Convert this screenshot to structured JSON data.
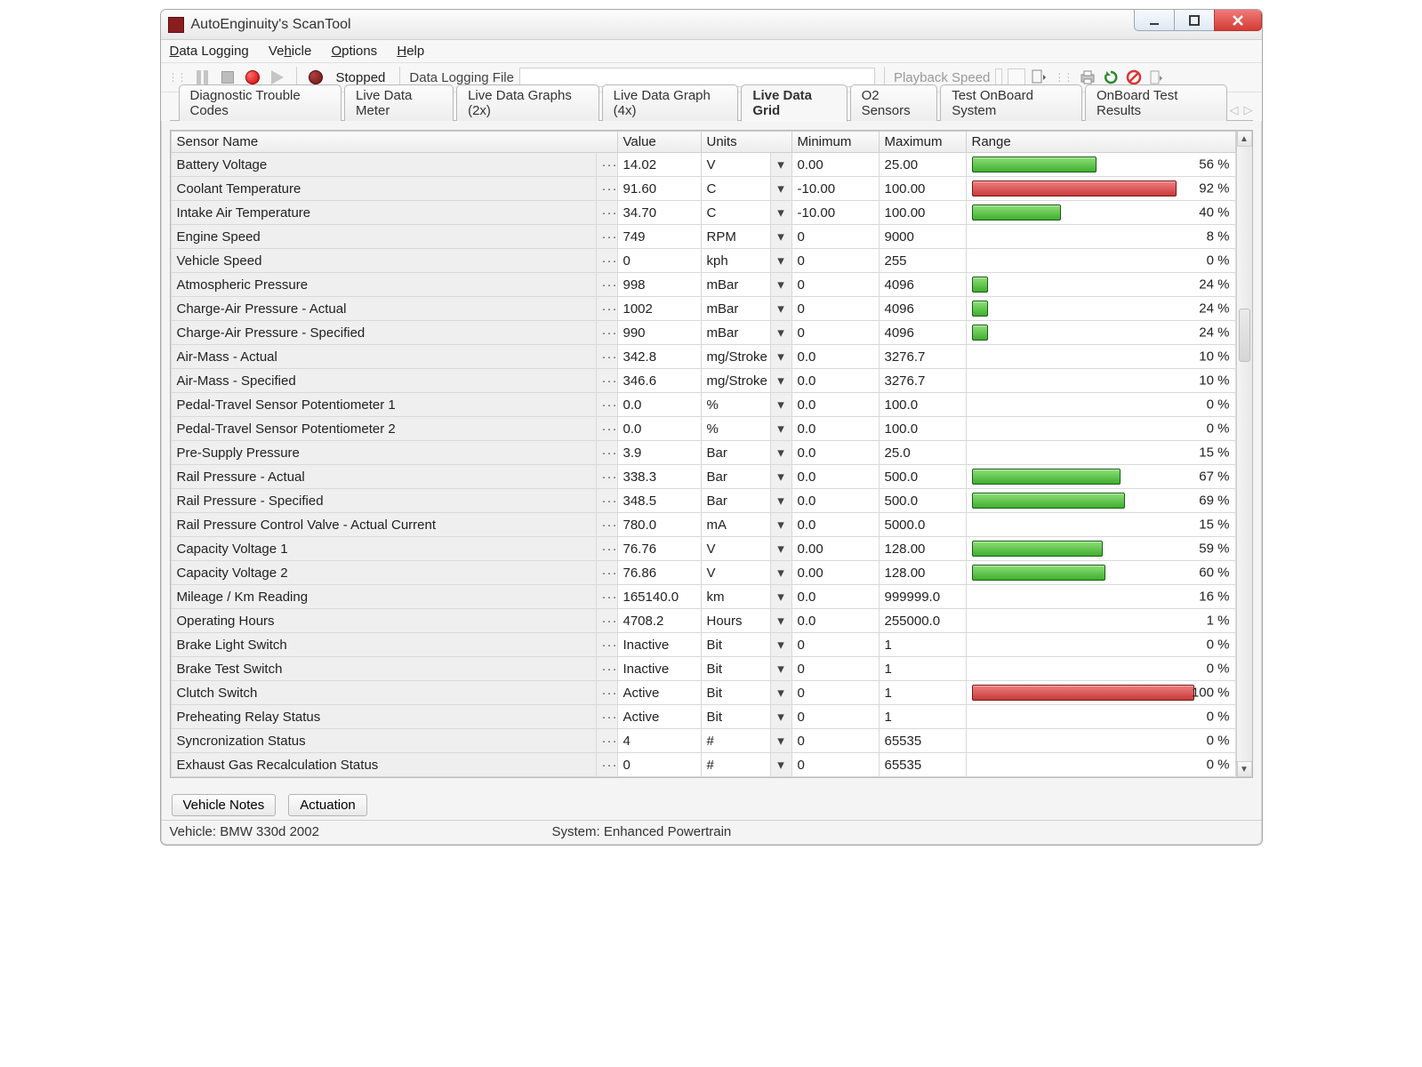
{
  "window": {
    "title": "AutoEnginuity's ScanTool"
  },
  "menu": {
    "data_logging": "Data Logging",
    "vehicle": "Vehicle",
    "options": "Options",
    "help": "Help"
  },
  "toolbar": {
    "stopped_label": "Stopped",
    "dlf_label": "Data Logging File",
    "playback_label": "Playback Speed"
  },
  "tabs": [
    "Diagnostic Trouble Codes",
    "Live Data Meter",
    "Live Data Graphs (2x)",
    "Live Data Graph (4x)",
    "Live Data Grid",
    "O2 Sensors",
    "Test OnBoard System",
    "OnBoard Test Results"
  ],
  "active_tab_index": 4,
  "grid": {
    "headers": {
      "name": "Sensor Name",
      "value": "Value",
      "units": "Units",
      "min": "Minimum",
      "max": "Maximum",
      "range": "Range"
    },
    "rows": [
      {
        "name": "Battery Voltage",
        "value": "14.02",
        "units": "V",
        "min": "0.00",
        "max": "25.00",
        "pct": 56,
        "bar": true,
        "color": "green"
      },
      {
        "name": "Coolant Temperature",
        "value": "91.60",
        "units": "C",
        "min": "-10.00",
        "max": "100.00",
        "pct": 92,
        "bar": true,
        "color": "red"
      },
      {
        "name": "Intake Air Temperature",
        "value": "34.70",
        "units": "C",
        "min": "-10.00",
        "max": "100.00",
        "pct": 40,
        "bar": true,
        "color": "green"
      },
      {
        "name": "Engine Speed",
        "value": "749",
        "units": "RPM",
        "min": "0",
        "max": "9000",
        "pct": 8,
        "bar": false
      },
      {
        "name": "Vehicle Speed",
        "value": "0",
        "units": "kph",
        "min": "0",
        "max": "255",
        "pct": 0,
        "bar": false
      },
      {
        "name": "Atmospheric Pressure",
        "value": "998",
        "units": "mBar",
        "min": "0",
        "max": "4096",
        "pct": 24,
        "bar": true,
        "bw": 6,
        "color": "green"
      },
      {
        "name": "Charge-Air Pressure - Actual",
        "value": "1002",
        "units": "mBar",
        "min": "0",
        "max": "4096",
        "pct": 24,
        "bar": true,
        "bw": 6,
        "color": "green"
      },
      {
        "name": "Charge-Air Pressure - Specified",
        "value": "990",
        "units": "mBar",
        "min": "0",
        "max": "4096",
        "pct": 24,
        "bar": true,
        "bw": 6,
        "color": "green"
      },
      {
        "name": "Air-Mass - Actual",
        "value": "342.8",
        "units": "mg/Stroke",
        "min": "0.0",
        "max": "3276.7",
        "pct": 10,
        "bar": false
      },
      {
        "name": "Air-Mass - Specified",
        "value": "346.6",
        "units": "mg/Stroke",
        "min": "0.0",
        "max": "3276.7",
        "pct": 10,
        "bar": false
      },
      {
        "name": "Pedal-Travel Sensor Potentiometer 1",
        "value": "0.0",
        "units": "%",
        "min": "0.0",
        "max": "100.0",
        "pct": 0,
        "bar": false
      },
      {
        "name": "Pedal-Travel Sensor Potentiometer 2",
        "value": "0.0",
        "units": "%",
        "min": "0.0",
        "max": "100.0",
        "pct": 0,
        "bar": false
      },
      {
        "name": "Pre-Supply Pressure",
        "value": "3.9",
        "units": "Bar",
        "min": "0.0",
        "max": "25.0",
        "pct": 15,
        "bar": false
      },
      {
        "name": "Rail Pressure - Actual",
        "value": "338.3",
        "units": "Bar",
        "min": "0.0",
        "max": "500.0",
        "pct": 67,
        "bar": true,
        "color": "green"
      },
      {
        "name": "Rail Pressure - Specified",
        "value": "348.5",
        "units": "Bar",
        "min": "0.0",
        "max": "500.0",
        "pct": 69,
        "bar": true,
        "color": "green"
      },
      {
        "name": "Rail Pressure Control Valve - Actual Current",
        "value": "780.0",
        "units": "mA",
        "min": "0.0",
        "max": "5000.0",
        "pct": 15,
        "bar": false
      },
      {
        "name": "Capacity Voltage 1",
        "value": "76.76",
        "units": "V",
        "min": "0.00",
        "max": "128.00",
        "pct": 59,
        "bar": true,
        "color": "green"
      },
      {
        "name": "Capacity Voltage 2",
        "value": "76.86",
        "units": "V",
        "min": "0.00",
        "max": "128.00",
        "pct": 60,
        "bar": true,
        "color": "green"
      },
      {
        "name": "Mileage / Km Reading",
        "value": "165140.0",
        "units": "km",
        "min": "0.0",
        "max": "999999.0",
        "pct": 16,
        "bar": false
      },
      {
        "name": "Operating Hours",
        "value": "4708.2",
        "units": "Hours",
        "min": "0.0",
        "max": "255000.0",
        "pct": 1,
        "bar": false
      },
      {
        "name": "Brake Light Switch",
        "value": "Inactive",
        "units": "Bit",
        "min": "0",
        "max": "1",
        "pct": 0,
        "bar": false
      },
      {
        "name": "Brake Test Switch",
        "value": "Inactive",
        "units": "Bit",
        "min": "0",
        "max": "1",
        "pct": 0,
        "bar": false
      },
      {
        "name": "Clutch Switch",
        "value": "Active",
        "units": "Bit",
        "min": "0",
        "max": "1",
        "pct": 100,
        "bar": true,
        "color": "red"
      },
      {
        "name": "Preheating Relay Status",
        "value": "Active",
        "units": "Bit",
        "min": "0",
        "max": "1",
        "pct": 0,
        "bar": false
      },
      {
        "name": "Syncronization Status",
        "value": "4",
        "units": "#",
        "min": "0",
        "max": "65535",
        "pct": 0,
        "bar": false
      },
      {
        "name": "Exhaust Gas Recalculation Status",
        "value": "0",
        "units": "#",
        "min": "0",
        "max": "65535",
        "pct": 0,
        "bar": false
      }
    ]
  },
  "bottom": {
    "notes": "Vehicle Notes",
    "actuation": "Actuation"
  },
  "status": {
    "vehicle": "Vehicle: BMW  330d  2002",
    "system": "System: Enhanced Powertrain"
  }
}
